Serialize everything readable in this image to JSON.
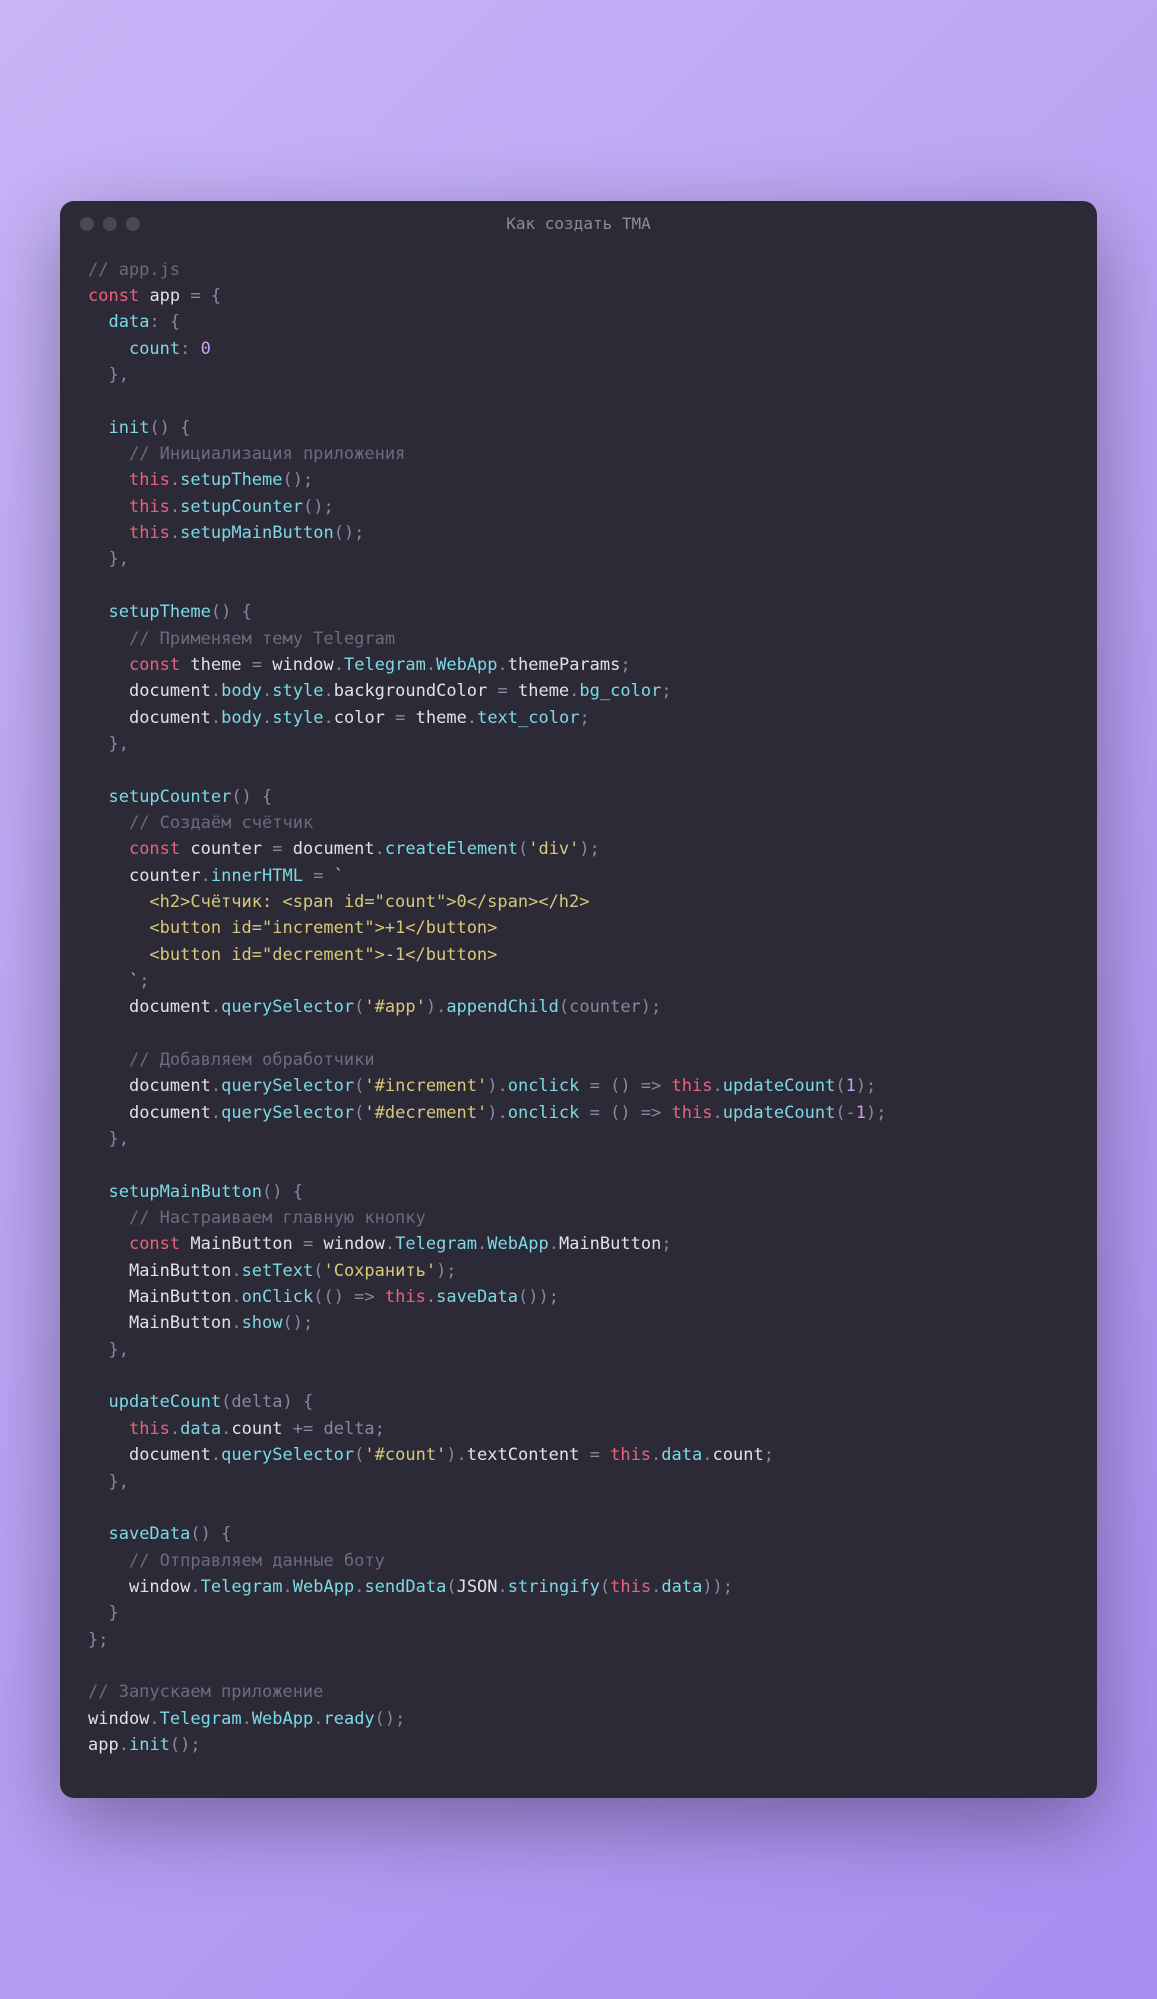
{
  "window": {
    "title": "Как создать TMA"
  },
  "code": {
    "l01_comment": "// app.js",
    "l02_const": "const",
    "l02_app": "app",
    "l02_eq": " = {",
    "l03_data": "data",
    "l03_colon": ": {",
    "l04_count": "count",
    "l04_colon": ": ",
    "l04_zero": "0",
    "l05_close": "},",
    "l07_init": "init",
    "l07_parens": "() {",
    "l08_comment": "// Инициализация приложения",
    "l09_this": "this",
    "l09_dot": ".",
    "l09_setupTheme": "setupTheme",
    "l09_call": "();",
    "l10_this": "this",
    "l10_dot": ".",
    "l10_setupCounter": "setupCounter",
    "l10_call": "();",
    "l11_this": "this",
    "l11_dot": ".",
    "l11_setupMainButton": "setupMainButton",
    "l11_call": "();",
    "l12_close": "},",
    "l14_setupTheme": "setupTheme",
    "l14_parens": "() {",
    "l15_comment": "// Применяем тему Telegram",
    "l16_const": "const",
    "l16_theme": "theme",
    "l16_eq": " = ",
    "l16_window": "window",
    "l16_d1": ".",
    "l16_Telegram": "Telegram",
    "l16_d2": ".",
    "l16_WebApp": "WebApp",
    "l16_d3": ".",
    "l16_themeParams": "themeParams",
    "l16_semi": ";",
    "l17_document": "document",
    "l17_d1": ".",
    "l17_body": "body",
    "l17_d2": ".",
    "l17_style": "style",
    "l17_d3": ".",
    "l17_backgroundColor": "backgroundColor",
    "l17_eq": " = ",
    "l17_theme": "theme",
    "l17_d4": ".",
    "l17_bg_color": "bg_color",
    "l17_semi": ";",
    "l18_document": "document",
    "l18_d1": ".",
    "l18_body": "body",
    "l18_d2": ".",
    "l18_style": "style",
    "l18_d3": ".",
    "l18_color": "color",
    "l18_eq": " = ",
    "l18_theme": "theme",
    "l18_d4": ".",
    "l18_text_color": "text_color",
    "l18_semi": ";",
    "l19_close": "},",
    "l21_setupCounter": "setupCounter",
    "l21_parens": "() {",
    "l22_comment": "// Создаём счётчик",
    "l23_const": "const",
    "l23_counter": "counter",
    "l23_eq": " = ",
    "l23_document": "document",
    "l23_d1": ".",
    "l23_createElement": "createElement",
    "l23_p1": "(",
    "l23_div": "'div'",
    "l23_p2": ");",
    "l24_counter": "counter",
    "l24_d1": ".",
    "l24_innerHTML": "innerHTML",
    "l24_eq": " = ",
    "l24_tick": "`",
    "l25_h2": "      <h2>Счётчик: <span id=\"count\">0</span></h2>",
    "l26_btn1": "      <button id=\"increment\">+1</button>",
    "l27_btn2": "      <button id=\"decrement\">-1</button>",
    "l28_tick": "    `",
    "l28_semi": ";",
    "l29_document": "document",
    "l29_d1": ".",
    "l29_querySelector": "querySelector",
    "l29_p1": "(",
    "l29_app": "'#app'",
    "l29_p2": ").",
    "l29_appendChild": "appendChild",
    "l29_p3": "(counter);",
    "l31_comment": "// Добавляем обработчики",
    "l32_document": "document",
    "l32_d1": ".",
    "l32_querySelector": "querySelector",
    "l32_p1": "(",
    "l32_inc": "'#increment'",
    "l32_p2": ").",
    "l32_onclick": "onclick",
    "l32_eq": " = ",
    "l32_arrow": "() => ",
    "l32_this": "this",
    "l32_d2": ".",
    "l32_updateCount": "updateCount",
    "l32_p3": "(",
    "l32_one": "1",
    "l32_p4": ");",
    "l33_document": "document",
    "l33_d1": ".",
    "l33_querySelector": "querySelector",
    "l33_p1": "(",
    "l33_dec": "'#decrement'",
    "l33_p2": ").",
    "l33_onclick": "onclick",
    "l33_eq": " = ",
    "l33_arrow": "() => ",
    "l33_this": "this",
    "l33_d2": ".",
    "l33_updateCount": "updateCount",
    "l33_p3": "(-",
    "l33_one": "1",
    "l33_p4": ");",
    "l34_close": "},",
    "l36_setupMainButton": "setupMainButton",
    "l36_parens": "() {",
    "l37_comment": "// Настраиваем главную кнопку",
    "l38_const": "const",
    "l38_MainButton": "MainButton",
    "l38_eq": " = ",
    "l38_window": "window",
    "l38_d1": ".",
    "l38_Telegram": "Telegram",
    "l38_d2": ".",
    "l38_WebApp": "WebApp",
    "l38_d3": ".",
    "l38_MainButton2": "MainButton",
    "l38_semi": ";",
    "l39_MainButton": "MainButton",
    "l39_d1": ".",
    "l39_setText": "setText",
    "l39_p1": "(",
    "l39_save": "'Сохранить'",
    "l39_p2": ");",
    "l40_MainButton": "MainButton",
    "l40_d1": ".",
    "l40_onClick": "onClick",
    "l40_p1": "(",
    "l40_arrow": "() => ",
    "l40_this": "this",
    "l40_d2": ".",
    "l40_saveData": "saveData",
    "l40_p2": "());",
    "l41_MainButton": "MainButton",
    "l41_d1": ".",
    "l41_show": "show",
    "l41_p1": "();",
    "l42_close": "},",
    "l44_updateCount": "updateCount",
    "l44_parens": "(delta) {",
    "l45_this": "this",
    "l45_d1": ".",
    "l45_data": "data",
    "l45_d2": ".",
    "l45_count": "count",
    "l45_eq": " += delta;",
    "l46_document": "document",
    "l46_d1": ".",
    "l46_querySelector": "querySelector",
    "l46_p1": "(",
    "l46_count": "'#count'",
    "l46_p2": ").",
    "l46_textContent": "textContent",
    "l46_eq": " = ",
    "l46_this": "this",
    "l46_d2": ".",
    "l46_data": "data",
    "l46_d3": ".",
    "l46_count2": "count",
    "l46_semi": ";",
    "l47_close": "},",
    "l49_saveData": "saveData",
    "l49_parens": "() {",
    "l50_comment": "// Отправляем данные боту",
    "l51_window": "window",
    "l51_d1": ".",
    "l51_Telegram": "Telegram",
    "l51_d2": ".",
    "l51_WebApp": "WebApp",
    "l51_d3": ".",
    "l51_sendData": "sendData",
    "l51_p1": "(",
    "l51_JSON": "JSON",
    "l51_d4": ".",
    "l51_stringify": "stringify",
    "l51_p2": "(",
    "l51_this": "this",
    "l51_d5": ".",
    "l51_data": "data",
    "l51_p3": "));",
    "l52_close": "}",
    "l53_close": "};",
    "l55_comment": "// Запускаем приложение",
    "l56_window": "window",
    "l56_d1": ".",
    "l56_Telegram": "Telegram",
    "l56_d2": ".",
    "l56_WebApp": "WebApp",
    "l56_d3": ".",
    "l56_ready": "ready",
    "l56_p1": "();",
    "l57_app": "app",
    "l57_d1": ".",
    "l57_init": "init",
    "l57_p1": "();"
  }
}
